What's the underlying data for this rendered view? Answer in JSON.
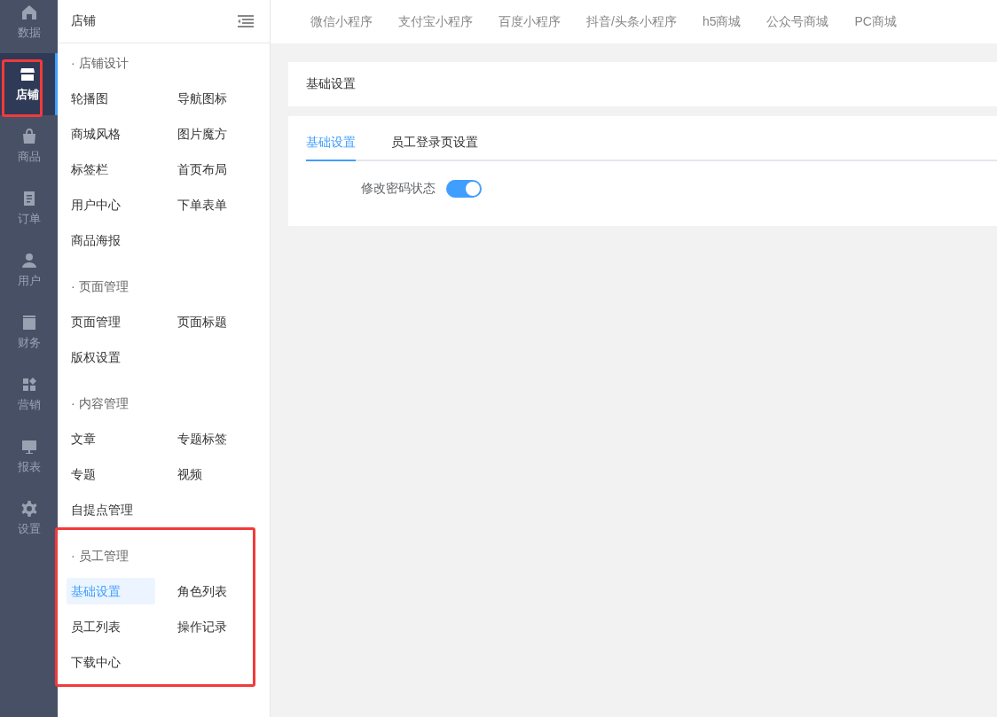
{
  "rail": [
    {
      "label": "数据",
      "selected": false,
      "highlighted": false
    },
    {
      "label": "店铺",
      "selected": true,
      "highlighted": true
    },
    {
      "label": "商品",
      "selected": false,
      "highlighted": false
    },
    {
      "label": "订单",
      "selected": false,
      "highlighted": false
    },
    {
      "label": "用户",
      "selected": false,
      "highlighted": false
    },
    {
      "label": "财务",
      "selected": false,
      "highlighted": false
    },
    {
      "label": "营销",
      "selected": false,
      "highlighted": false
    },
    {
      "label": "报表",
      "selected": false,
      "highlighted": false
    },
    {
      "label": "设置",
      "selected": false,
      "highlighted": false
    }
  ],
  "sidebar": {
    "title": "店铺",
    "groups": [
      {
        "title": "· 店铺设计",
        "highlighted": false,
        "items": [
          {
            "label": "轮播图",
            "selected": false
          },
          {
            "label": "导航图标",
            "selected": false
          },
          {
            "label": "商城风格",
            "selected": false
          },
          {
            "label": "图片魔方",
            "selected": false
          },
          {
            "label": "标签栏",
            "selected": false
          },
          {
            "label": "首页布局",
            "selected": false
          },
          {
            "label": "用户中心",
            "selected": false
          },
          {
            "label": "下单表单",
            "selected": false
          },
          {
            "label": "商品海报",
            "selected": false
          }
        ]
      },
      {
        "title": "· 页面管理",
        "highlighted": false,
        "items": [
          {
            "label": "页面管理",
            "selected": false
          },
          {
            "label": "页面标题",
            "selected": false
          },
          {
            "label": "版权设置",
            "selected": false
          }
        ]
      },
      {
        "title": "· 内容管理",
        "highlighted": false,
        "items": [
          {
            "label": "文章",
            "selected": false
          },
          {
            "label": "专题标签",
            "selected": false
          },
          {
            "label": "专题",
            "selected": false
          },
          {
            "label": "视频",
            "selected": false
          },
          {
            "label": "自提点管理",
            "selected": false
          }
        ]
      },
      {
        "title": "· 员工管理",
        "highlighted": true,
        "items": [
          {
            "label": "基础设置",
            "selected": true
          },
          {
            "label": "角色列表",
            "selected": false
          },
          {
            "label": "员工列表",
            "selected": false
          },
          {
            "label": "操作记录",
            "selected": false
          },
          {
            "label": "下载中心",
            "selected": false
          }
        ]
      }
    ]
  },
  "platform_tabs": [
    "微信小程序",
    "支付宝小程序",
    "百度小程序",
    "抖音/头条小程序",
    "h5商城",
    "公众号商城",
    "PC商城"
  ],
  "page_title": "基础设置",
  "tabs": [
    {
      "label": "基础设置",
      "selected": true
    },
    {
      "label": "员工登录页设置",
      "selected": false
    }
  ],
  "form": [
    {
      "label": "修改密码状态",
      "on": true
    }
  ]
}
